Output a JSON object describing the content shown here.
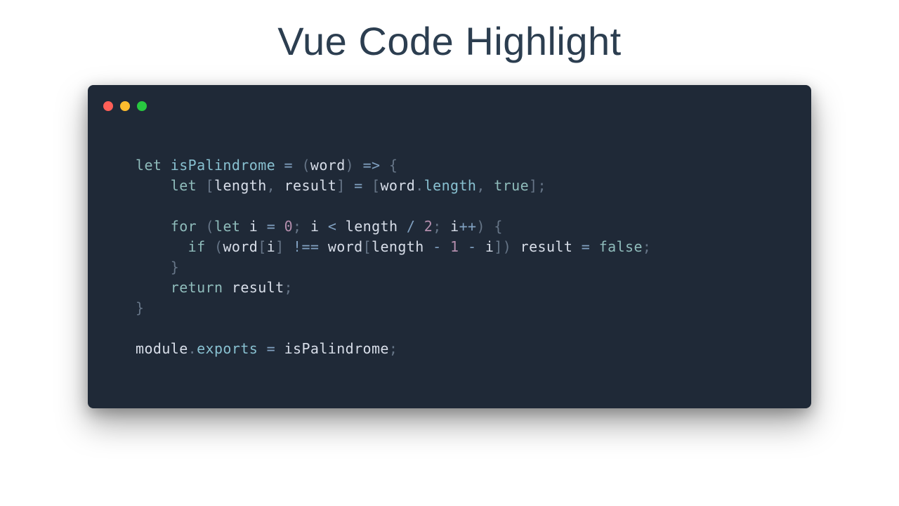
{
  "page": {
    "title": "Vue Code Highlight"
  },
  "editor": {
    "language": "javascript",
    "theme": "nord-dark",
    "window_controls": [
      "close",
      "minimize",
      "zoom"
    ]
  },
  "code": {
    "tokens": [
      [
        {
          "t": "kw",
          "v": "let"
        },
        {
          "t": "sp",
          "v": " "
        },
        {
          "t": "fn",
          "v": "isPalindrome"
        },
        {
          "t": "sp",
          "v": " "
        },
        {
          "t": "op",
          "v": "="
        },
        {
          "t": "sp",
          "v": " "
        },
        {
          "t": "punc",
          "v": "("
        },
        {
          "t": "param",
          "v": "word"
        },
        {
          "t": "punc",
          "v": ")"
        },
        {
          "t": "sp",
          "v": " "
        },
        {
          "t": "op",
          "v": "=>"
        },
        {
          "t": "sp",
          "v": " "
        },
        {
          "t": "punc",
          "v": "{"
        }
      ],
      [
        {
          "t": "indent",
          "v": "    "
        },
        {
          "t": "kw",
          "v": "let"
        },
        {
          "t": "sp",
          "v": " "
        },
        {
          "t": "punc",
          "v": "["
        },
        {
          "t": "id",
          "v": "length"
        },
        {
          "t": "punc",
          "v": ","
        },
        {
          "t": "sp",
          "v": " "
        },
        {
          "t": "id",
          "v": "result"
        },
        {
          "t": "punc",
          "v": "]"
        },
        {
          "t": "sp",
          "v": " "
        },
        {
          "t": "op",
          "v": "="
        },
        {
          "t": "sp",
          "v": " "
        },
        {
          "t": "punc",
          "v": "["
        },
        {
          "t": "id",
          "v": "word"
        },
        {
          "t": "punc",
          "v": "."
        },
        {
          "t": "prop",
          "v": "length"
        },
        {
          "t": "punc",
          "v": ","
        },
        {
          "t": "sp",
          "v": " "
        },
        {
          "t": "bool",
          "v": "true"
        },
        {
          "t": "punc",
          "v": "]"
        },
        {
          "t": "punc",
          "v": ";"
        }
      ],
      [
        {
          "t": "blank",
          "v": ""
        }
      ],
      [
        {
          "t": "indent",
          "v": "    "
        },
        {
          "t": "kw",
          "v": "for"
        },
        {
          "t": "sp",
          "v": " "
        },
        {
          "t": "punc",
          "v": "("
        },
        {
          "t": "kw",
          "v": "let"
        },
        {
          "t": "sp",
          "v": " "
        },
        {
          "t": "id",
          "v": "i"
        },
        {
          "t": "sp",
          "v": " "
        },
        {
          "t": "op",
          "v": "="
        },
        {
          "t": "sp",
          "v": " "
        },
        {
          "t": "num",
          "v": "0"
        },
        {
          "t": "punc",
          "v": ";"
        },
        {
          "t": "sp",
          "v": " "
        },
        {
          "t": "id",
          "v": "i"
        },
        {
          "t": "sp",
          "v": " "
        },
        {
          "t": "op",
          "v": "<"
        },
        {
          "t": "sp",
          "v": " "
        },
        {
          "t": "id",
          "v": "length"
        },
        {
          "t": "sp",
          "v": " "
        },
        {
          "t": "op",
          "v": "/"
        },
        {
          "t": "sp",
          "v": " "
        },
        {
          "t": "num",
          "v": "2"
        },
        {
          "t": "punc",
          "v": ";"
        },
        {
          "t": "sp",
          "v": " "
        },
        {
          "t": "id",
          "v": "i"
        },
        {
          "t": "op",
          "v": "++"
        },
        {
          "t": "punc",
          "v": ")"
        },
        {
          "t": "sp",
          "v": " "
        },
        {
          "t": "punc",
          "v": "{"
        }
      ],
      [
        {
          "t": "indent",
          "v": "      "
        },
        {
          "t": "kw",
          "v": "if"
        },
        {
          "t": "sp",
          "v": " "
        },
        {
          "t": "punc",
          "v": "("
        },
        {
          "t": "id",
          "v": "word"
        },
        {
          "t": "punc",
          "v": "["
        },
        {
          "t": "id",
          "v": "i"
        },
        {
          "t": "punc",
          "v": "]"
        },
        {
          "t": "sp",
          "v": " "
        },
        {
          "t": "op",
          "v": "!=="
        },
        {
          "t": "sp",
          "v": " "
        },
        {
          "t": "id",
          "v": "word"
        },
        {
          "t": "punc",
          "v": "["
        },
        {
          "t": "id",
          "v": "length"
        },
        {
          "t": "sp",
          "v": " "
        },
        {
          "t": "op",
          "v": "-"
        },
        {
          "t": "sp",
          "v": " "
        },
        {
          "t": "num",
          "v": "1"
        },
        {
          "t": "sp",
          "v": " "
        },
        {
          "t": "op",
          "v": "-"
        },
        {
          "t": "sp",
          "v": " "
        },
        {
          "t": "id",
          "v": "i"
        },
        {
          "t": "punc",
          "v": "]"
        },
        {
          "t": "punc",
          "v": ")"
        },
        {
          "t": "sp",
          "v": " "
        },
        {
          "t": "id",
          "v": "result"
        },
        {
          "t": "sp",
          "v": " "
        },
        {
          "t": "op",
          "v": "="
        },
        {
          "t": "sp",
          "v": " "
        },
        {
          "t": "bool",
          "v": "false"
        },
        {
          "t": "punc",
          "v": ";"
        }
      ],
      [
        {
          "t": "indent",
          "v": "    "
        },
        {
          "t": "punc",
          "v": "}"
        }
      ],
      [
        {
          "t": "indent",
          "v": "    "
        },
        {
          "t": "kw",
          "v": "return"
        },
        {
          "t": "sp",
          "v": " "
        },
        {
          "t": "id",
          "v": "result"
        },
        {
          "t": "punc",
          "v": ";"
        }
      ],
      [
        {
          "t": "punc",
          "v": "}"
        }
      ],
      [
        {
          "t": "blank",
          "v": ""
        }
      ],
      [
        {
          "t": "id",
          "v": "module"
        },
        {
          "t": "punc",
          "v": "."
        },
        {
          "t": "prop",
          "v": "exports"
        },
        {
          "t": "sp",
          "v": " "
        },
        {
          "t": "op",
          "v": "="
        },
        {
          "t": "sp",
          "v": " "
        },
        {
          "t": "id",
          "v": "isPalindrome"
        },
        {
          "t": "punc",
          "v": ";"
        }
      ]
    ],
    "plain": "let isPalindrome = (word) => {\n    let [length, result] = [word.length, true];\n\n    for (let i = 0; i < length / 2; i++) {\n      if (word[i] !== word[length - 1 - i]) result = false;\n    }\n    return result;\n}\n\nmodule.exports = isPalindrome;"
  },
  "colors": {
    "editor_bg": "#1f2937",
    "keyword": "#8fbcbb",
    "function": "#88c0d0",
    "identifier": "#d8dee9",
    "operator": "#81a1c1",
    "punctuation": "#667587",
    "number": "#b48ead",
    "boolean": "#8fbcbb"
  }
}
